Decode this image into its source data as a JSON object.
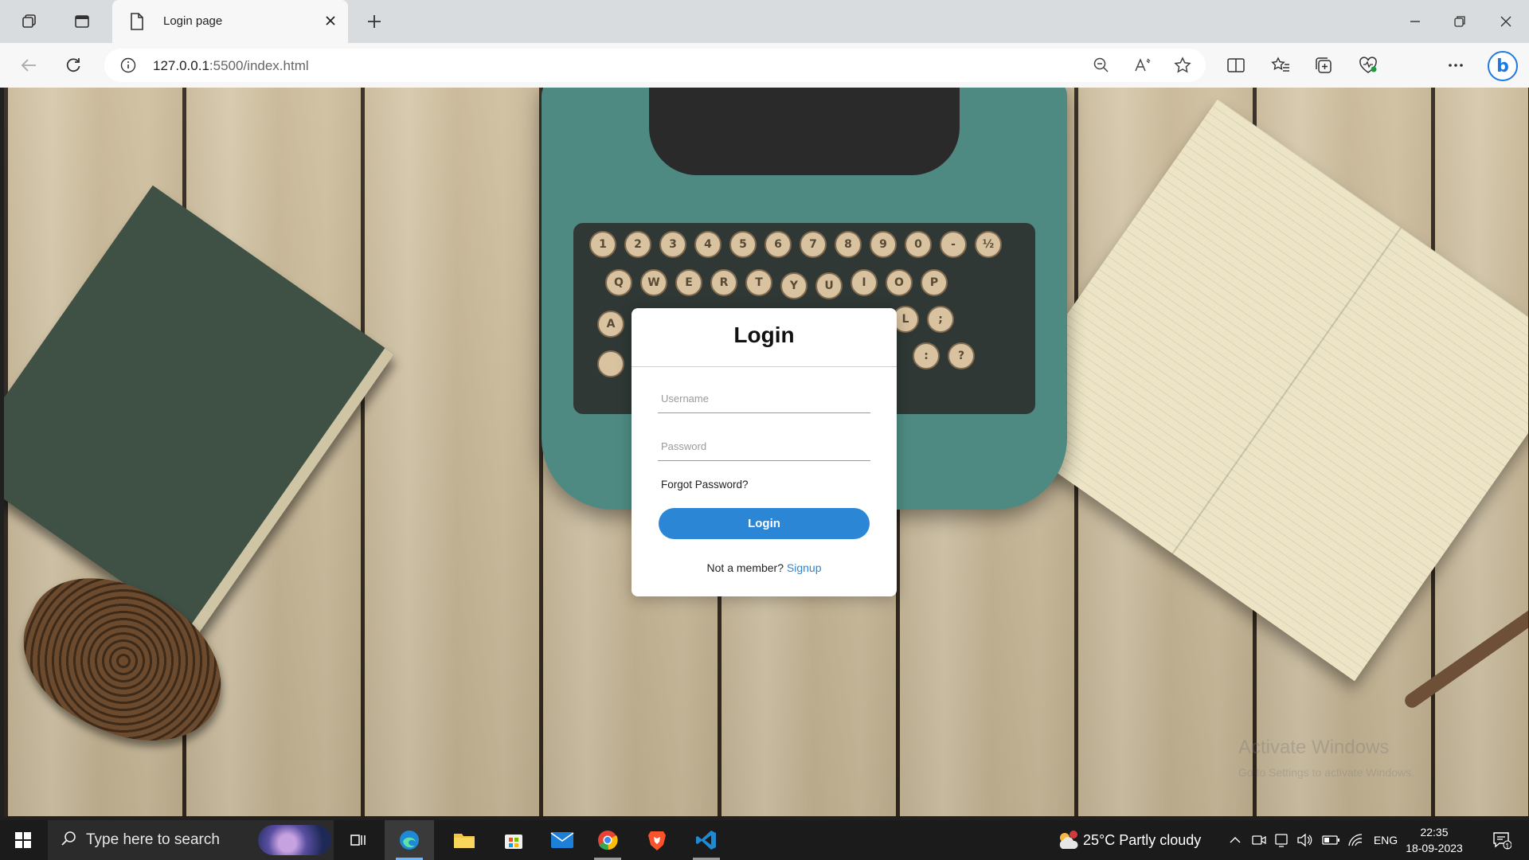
{
  "browser": {
    "tab_title": "Login page",
    "url_host": "127.0.0.1",
    "url_rest": ":5500/index.html"
  },
  "login": {
    "heading": "Login",
    "username_placeholder": "Username",
    "password_placeholder": "Password",
    "forgot_label": "Forgot Password?",
    "button_label": "Login",
    "not_member_text": "Not a member?",
    "signup_label": "Signup"
  },
  "watermark": {
    "line1": "Activate Windows",
    "line2": "Go to Settings to activate Windows."
  },
  "taskbar": {
    "search_placeholder": "Type here to search",
    "weather": "25°C  Partly cloudy",
    "language": "ENG",
    "time": "22:35",
    "date": "18-09-2023",
    "notification_count": "1"
  },
  "colors": {
    "accent": "#2b86d6",
    "taskbar": "#1b1b1b",
    "chrome": "#f7f7f7"
  }
}
